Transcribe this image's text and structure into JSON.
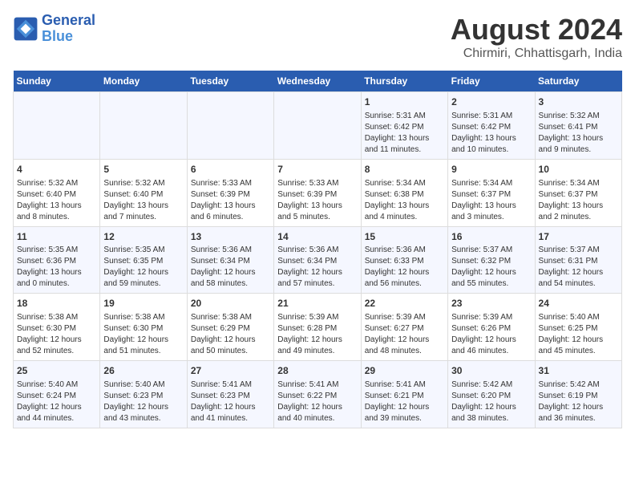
{
  "header": {
    "logo_line1": "General",
    "logo_line2": "Blue",
    "main_title": "August 2024",
    "subtitle": "Chirmiri, Chhattisgarh, India"
  },
  "days_of_week": [
    "Sunday",
    "Monday",
    "Tuesday",
    "Wednesday",
    "Thursday",
    "Friday",
    "Saturday"
  ],
  "weeks": [
    [
      {
        "day": "",
        "content": ""
      },
      {
        "day": "",
        "content": ""
      },
      {
        "day": "",
        "content": ""
      },
      {
        "day": "",
        "content": ""
      },
      {
        "day": "1",
        "content": "Sunrise: 5:31 AM\nSunset: 6:42 PM\nDaylight: 13 hours and 11 minutes."
      },
      {
        "day": "2",
        "content": "Sunrise: 5:31 AM\nSunset: 6:42 PM\nDaylight: 13 hours and 10 minutes."
      },
      {
        "day": "3",
        "content": "Sunrise: 5:32 AM\nSunset: 6:41 PM\nDaylight: 13 hours and 9 minutes."
      }
    ],
    [
      {
        "day": "4",
        "content": "Sunrise: 5:32 AM\nSunset: 6:40 PM\nDaylight: 13 hours and 8 minutes."
      },
      {
        "day": "5",
        "content": "Sunrise: 5:32 AM\nSunset: 6:40 PM\nDaylight: 13 hours and 7 minutes."
      },
      {
        "day": "6",
        "content": "Sunrise: 5:33 AM\nSunset: 6:39 PM\nDaylight: 13 hours and 6 minutes."
      },
      {
        "day": "7",
        "content": "Sunrise: 5:33 AM\nSunset: 6:39 PM\nDaylight: 13 hours and 5 minutes."
      },
      {
        "day": "8",
        "content": "Sunrise: 5:34 AM\nSunset: 6:38 PM\nDaylight: 13 hours and 4 minutes."
      },
      {
        "day": "9",
        "content": "Sunrise: 5:34 AM\nSunset: 6:37 PM\nDaylight: 13 hours and 3 minutes."
      },
      {
        "day": "10",
        "content": "Sunrise: 5:34 AM\nSunset: 6:37 PM\nDaylight: 13 hours and 2 minutes."
      }
    ],
    [
      {
        "day": "11",
        "content": "Sunrise: 5:35 AM\nSunset: 6:36 PM\nDaylight: 13 hours and 0 minutes."
      },
      {
        "day": "12",
        "content": "Sunrise: 5:35 AM\nSunset: 6:35 PM\nDaylight: 12 hours and 59 minutes."
      },
      {
        "day": "13",
        "content": "Sunrise: 5:36 AM\nSunset: 6:34 PM\nDaylight: 12 hours and 58 minutes."
      },
      {
        "day": "14",
        "content": "Sunrise: 5:36 AM\nSunset: 6:34 PM\nDaylight: 12 hours and 57 minutes."
      },
      {
        "day": "15",
        "content": "Sunrise: 5:36 AM\nSunset: 6:33 PM\nDaylight: 12 hours and 56 minutes."
      },
      {
        "day": "16",
        "content": "Sunrise: 5:37 AM\nSunset: 6:32 PM\nDaylight: 12 hours and 55 minutes."
      },
      {
        "day": "17",
        "content": "Sunrise: 5:37 AM\nSunset: 6:31 PM\nDaylight: 12 hours and 54 minutes."
      }
    ],
    [
      {
        "day": "18",
        "content": "Sunrise: 5:38 AM\nSunset: 6:30 PM\nDaylight: 12 hours and 52 minutes."
      },
      {
        "day": "19",
        "content": "Sunrise: 5:38 AM\nSunset: 6:30 PM\nDaylight: 12 hours and 51 minutes."
      },
      {
        "day": "20",
        "content": "Sunrise: 5:38 AM\nSunset: 6:29 PM\nDaylight: 12 hours and 50 minutes."
      },
      {
        "day": "21",
        "content": "Sunrise: 5:39 AM\nSunset: 6:28 PM\nDaylight: 12 hours and 49 minutes."
      },
      {
        "day": "22",
        "content": "Sunrise: 5:39 AM\nSunset: 6:27 PM\nDaylight: 12 hours and 48 minutes."
      },
      {
        "day": "23",
        "content": "Sunrise: 5:39 AM\nSunset: 6:26 PM\nDaylight: 12 hours and 46 minutes."
      },
      {
        "day": "24",
        "content": "Sunrise: 5:40 AM\nSunset: 6:25 PM\nDaylight: 12 hours and 45 minutes."
      }
    ],
    [
      {
        "day": "25",
        "content": "Sunrise: 5:40 AM\nSunset: 6:24 PM\nDaylight: 12 hours and 44 minutes."
      },
      {
        "day": "26",
        "content": "Sunrise: 5:40 AM\nSunset: 6:23 PM\nDaylight: 12 hours and 43 minutes."
      },
      {
        "day": "27",
        "content": "Sunrise: 5:41 AM\nSunset: 6:23 PM\nDaylight: 12 hours and 41 minutes."
      },
      {
        "day": "28",
        "content": "Sunrise: 5:41 AM\nSunset: 6:22 PM\nDaylight: 12 hours and 40 minutes."
      },
      {
        "day": "29",
        "content": "Sunrise: 5:41 AM\nSunset: 6:21 PM\nDaylight: 12 hours and 39 minutes."
      },
      {
        "day": "30",
        "content": "Sunrise: 5:42 AM\nSunset: 6:20 PM\nDaylight: 12 hours and 38 minutes."
      },
      {
        "day": "31",
        "content": "Sunrise: 5:42 AM\nSunset: 6:19 PM\nDaylight: 12 hours and 36 minutes."
      }
    ]
  ]
}
